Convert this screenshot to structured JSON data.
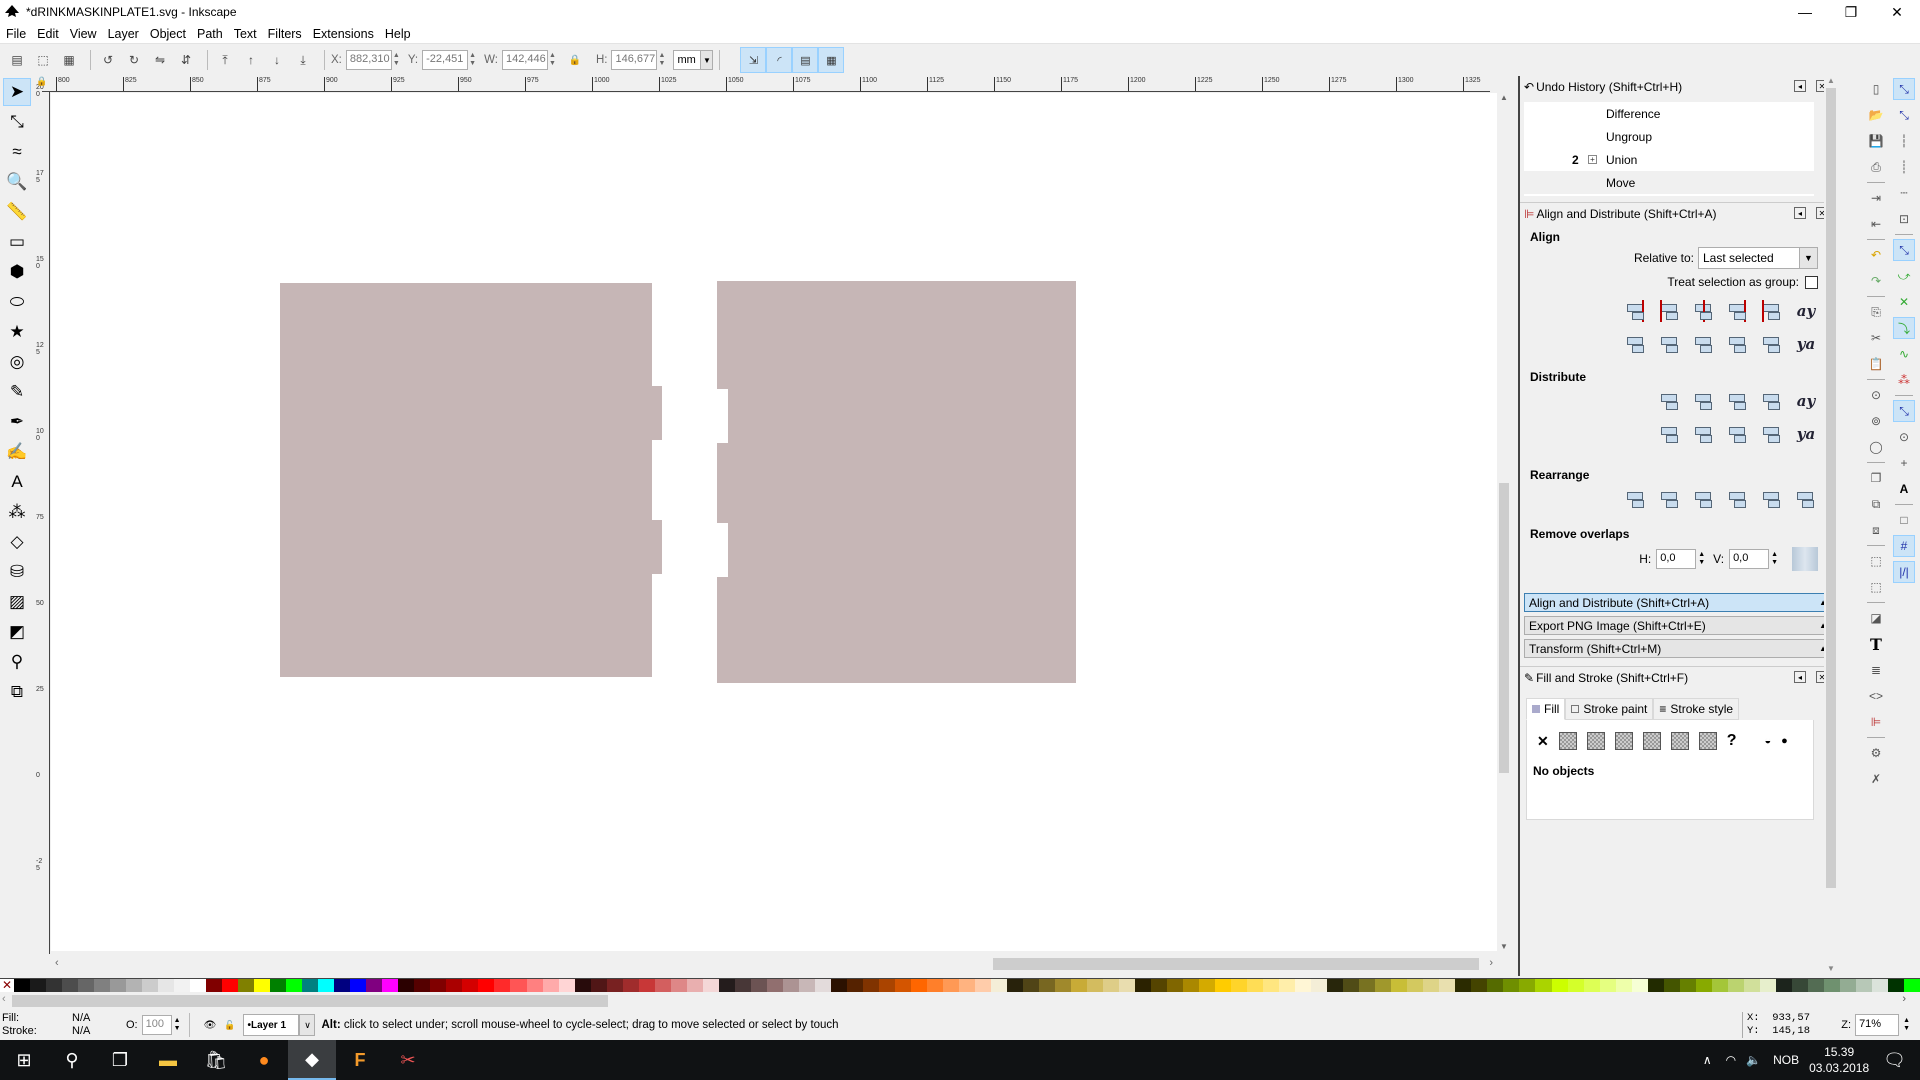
{
  "window": {
    "title": "*dRINKMASKINPLATE1.svg - Inkscape",
    "minimize": "—",
    "maximize": "❐",
    "close": "✕"
  },
  "menu": [
    "File",
    "Edit",
    "View",
    "Layer",
    "Object",
    "Path",
    "Text",
    "Filters",
    "Extensions",
    "Help"
  ],
  "toolbar": {
    "x_label": "X:",
    "x_value": "882,310",
    "y_label": "Y:",
    "y_value": "-22,451",
    "w_label": "W:",
    "w_value": "142,446",
    "h_label": "H:",
    "h_value": "146,677",
    "unit": "mm",
    "lock_icon": "lock-icon"
  },
  "rulers": {
    "horizontal": [
      "800",
      "825",
      "850",
      "875",
      "900",
      "925",
      "950",
      "975",
      "1000",
      "1025",
      "1050",
      "1075",
      "1100",
      "1125",
      "1150",
      "1175",
      "1200",
      "1225",
      "1250",
      "1275",
      "1300",
      "1325"
    ],
    "vertical": [
      "200",
      "175",
      "150",
      "125",
      "100",
      "75",
      "50",
      "25",
      "0",
      "-25"
    ]
  },
  "tools": [
    {
      "name": "selector",
      "glyph": "➤"
    },
    {
      "name": "node",
      "glyph": "⤡"
    },
    {
      "name": "tweak",
      "glyph": "≈"
    },
    {
      "name": "zoom",
      "glyph": "🔍"
    },
    {
      "name": "measure",
      "glyph": "📏"
    },
    {
      "name": "rectangle",
      "glyph": "▭"
    },
    {
      "name": "3d-box",
      "glyph": "⬢"
    },
    {
      "name": "ellipse",
      "glyph": "⬭"
    },
    {
      "name": "star",
      "glyph": "★"
    },
    {
      "name": "spiral",
      "glyph": "◎"
    },
    {
      "name": "pencil",
      "glyph": "✎"
    },
    {
      "name": "pen",
      "glyph": "✒"
    },
    {
      "name": "calligraphy",
      "glyph": "✍"
    },
    {
      "name": "text",
      "glyph": "A"
    },
    {
      "name": "spray",
      "glyph": "⁂"
    },
    {
      "name": "eraser",
      "glyph": "◇"
    },
    {
      "name": "paint-bucket",
      "glyph": "⛁"
    },
    {
      "name": "gradient",
      "glyph": "▨"
    },
    {
      "name": "mesh",
      "glyph": "◩"
    },
    {
      "name": "dropper",
      "glyph": "⚲"
    },
    {
      "name": "connector",
      "glyph": "⧉"
    }
  ],
  "undo_history": {
    "title": "Undo History (Shift+Ctrl+H)",
    "items": [
      {
        "label": "Difference",
        "count": ""
      },
      {
        "label": "Ungroup",
        "count": ""
      },
      {
        "label": "Union",
        "count": "2",
        "expandable": true
      },
      {
        "label": "Move",
        "count": "",
        "current": true
      }
    ]
  },
  "align": {
    "title": "Align and Distribute (Shift+Ctrl+A)",
    "align_heading": "Align",
    "relative_label": "Relative to:",
    "relative_value": "Last selected",
    "treat_group_label": "Treat selection as group:",
    "treat_group_checked": false,
    "distribute_heading": "Distribute",
    "rearrange_heading": "Rearrange",
    "remove_overlaps_heading": "Remove overlaps",
    "h_label": "H:",
    "h_value": "0,0",
    "v_label": "V:",
    "v_value": "0,0"
  },
  "collapsed_panels": [
    {
      "label": "Align and Distribute (Shift+Ctrl+A)",
      "active": true
    },
    {
      "label": "Export PNG Image (Shift+Ctrl+E)",
      "active": false
    },
    {
      "label": "Transform (Shift+Ctrl+M)",
      "active": false
    }
  ],
  "fill_stroke": {
    "title": "Fill and Stroke (Shift+Ctrl+F)",
    "tabs": [
      "Fill",
      "Stroke paint",
      "Stroke style"
    ],
    "active_tab": "Fill",
    "status": "No objects",
    "paint_none": "✕",
    "paint_unknown": "?"
  },
  "canvas": {
    "shape_fill": "#c6b6b6"
  },
  "palette": [
    "#000000",
    "#1a1a1a",
    "#333333",
    "#4d4d4d",
    "#666666",
    "#808080",
    "#999999",
    "#b3b3b3",
    "#cccccc",
    "#e6e6e6",
    "#f2f2f2",
    "#ffffff",
    "#800000",
    "#ff0000",
    "#808000",
    "#ffff00",
    "#008000",
    "#00ff00",
    "#008080",
    "#00ffff",
    "#000080",
    "#0000ff",
    "#800080",
    "#ff00ff",
    "#2b0000",
    "#550000",
    "#800000",
    "#aa0000",
    "#d40000",
    "#ff0000",
    "#ff2a2a",
    "#ff5555",
    "#ff8080",
    "#ffaaaa",
    "#ffd5d5",
    "#280b0b",
    "#501616",
    "#782121",
    "#a02c2c",
    "#c83737",
    "#d35f5f",
    "#de8787",
    "#e9afaf",
    "#f4d7d7",
    "#241c1c",
    "#483737",
    "#6c5353",
    "#916f6f",
    "#ac9393",
    "#c8b7b7",
    "#e3dbdb",
    "#2b1100",
    "#552200",
    "#803300",
    "#aa4400",
    "#d45500",
    "#ff6600",
    "#ff7f2a",
    "#ff9955",
    "#ffb380",
    "#ffccaa",
    "#f4eed7",
    "#28220b",
    "#504416",
    "#786721",
    "#a0892c",
    "#c8ab37",
    "#d3bc5f",
    "#decd87",
    "#e9ddaf",
    "#2b2200",
    "#554400",
    "#806600",
    "#aa8800",
    "#d4aa00",
    "#ffcc00",
    "#ffd42a",
    "#ffdd55",
    "#ffe680",
    "#ffeeaa",
    "#fff6d5",
    "#f4eed7",
    "#28260b",
    "#504c16",
    "#787221",
    "#a0982c",
    "#c8be37",
    "#d3c95f",
    "#ded487",
    "#e9e0af",
    "#2b2b00",
    "#444400",
    "#556b00",
    "#6f8f00",
    "#88aa00",
    "#aad400",
    "#ccff00",
    "#d4ff2a",
    "#ddff55",
    "#e5ff80",
    "#eeffaa",
    "#f6ffd5",
    "#222b00",
    "#445500",
    "#668000",
    "#88aa00",
    "#a4c639",
    "#bbd36f",
    "#d1e09b",
    "#e7efcc",
    "#1c241c",
    "#374837",
    "#536c53",
    "#6f916f",
    "#93ac93",
    "#b7c8b7",
    "#dbe3db",
    "#003300",
    "#00ff00"
  ],
  "status": {
    "fill_label": "Fill:",
    "fill_value": "N/A",
    "stroke_label": "Stroke:",
    "stroke_value": "N/A",
    "opacity_label": "O:",
    "opacity_value": "100",
    "layer": "•Layer 1",
    "message_bold": "Alt:",
    "message": " click to select under; scroll mouse-wheel to cycle-select; drag to move selected or select by touch",
    "cursor_x_label": "X:",
    "cursor_x": "933,57",
    "cursor_y_label": "Y:",
    "cursor_y": "145,18",
    "zoom_label": "Z:",
    "zoom_value": "71%"
  },
  "taskbar": {
    "apps": [
      "start",
      "search",
      "task-view",
      "file-explorer",
      "store",
      "firefox",
      "inkscape",
      "fusion",
      "snipping-tool"
    ],
    "language": "NOB",
    "time": "15.39",
    "date": "03.03.2018"
  }
}
